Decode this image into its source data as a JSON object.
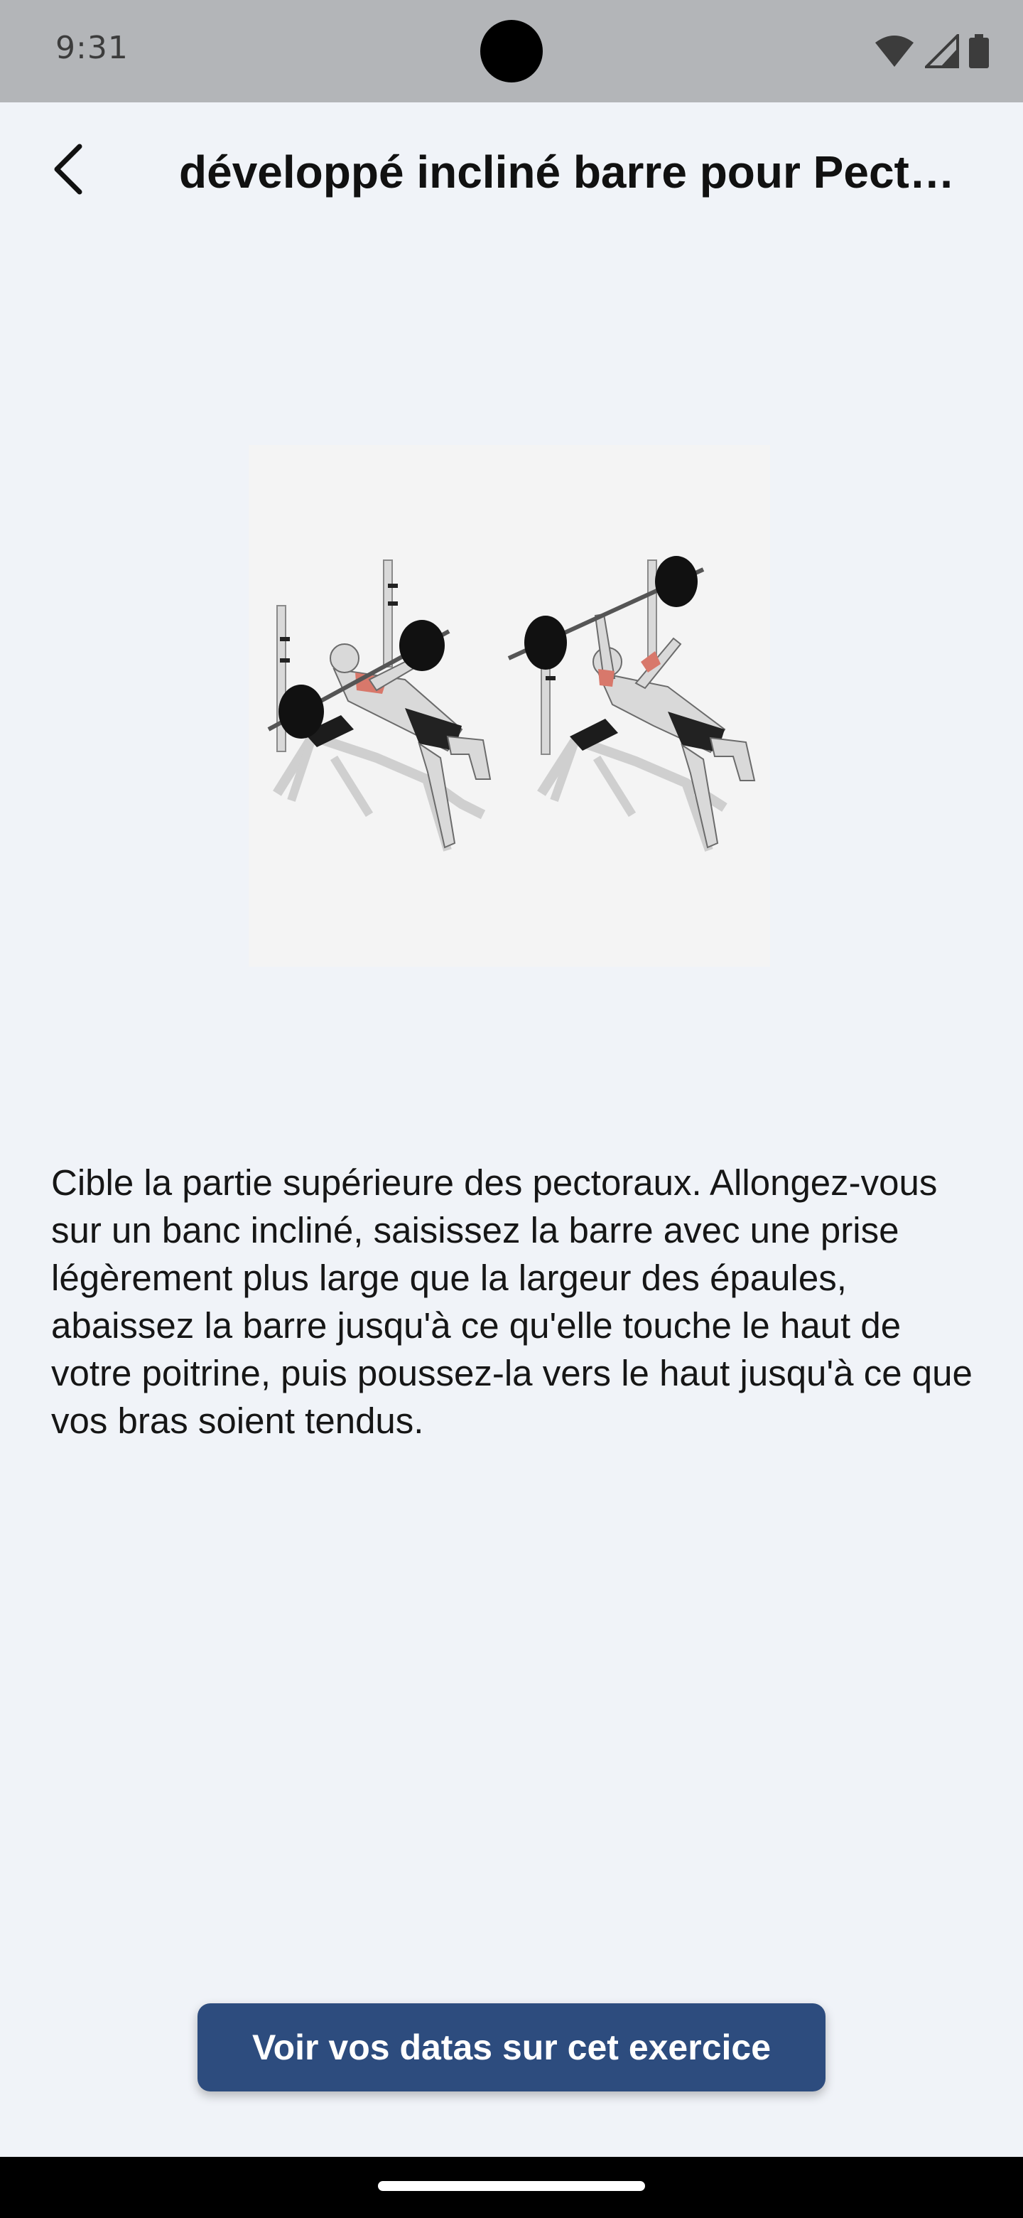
{
  "status_bar": {
    "time": "9:31",
    "icons": [
      "wifi-icon",
      "cellular-signal-icon",
      "battery-icon"
    ]
  },
  "header": {
    "back_icon": "arrow-back-icon",
    "title": "développé incliné barre pour Pectoraux"
  },
  "exercise": {
    "image_name": "incline-barbell-bench-press-illustration",
    "description": "Cible la partie supérieure des pectoraux. Allongez-vous sur un banc incliné, saisissez la barre avec une prise légèrement plus large que la largeur des épaules, abaissez la barre jusqu'à ce qu'elle touche le haut de votre poitrine, puis poussez-la vers le haut jusqu'à ce que vos bras soient tendus."
  },
  "actions": {
    "view_data_label": "Voir vos datas sur cet exercice"
  },
  "colors": {
    "background": "#f0f3f8",
    "status_bar": "#b3b5b8",
    "button": "#2d4c7e",
    "button_text": "#ffffff",
    "muscle_highlight": "#d8786b"
  }
}
